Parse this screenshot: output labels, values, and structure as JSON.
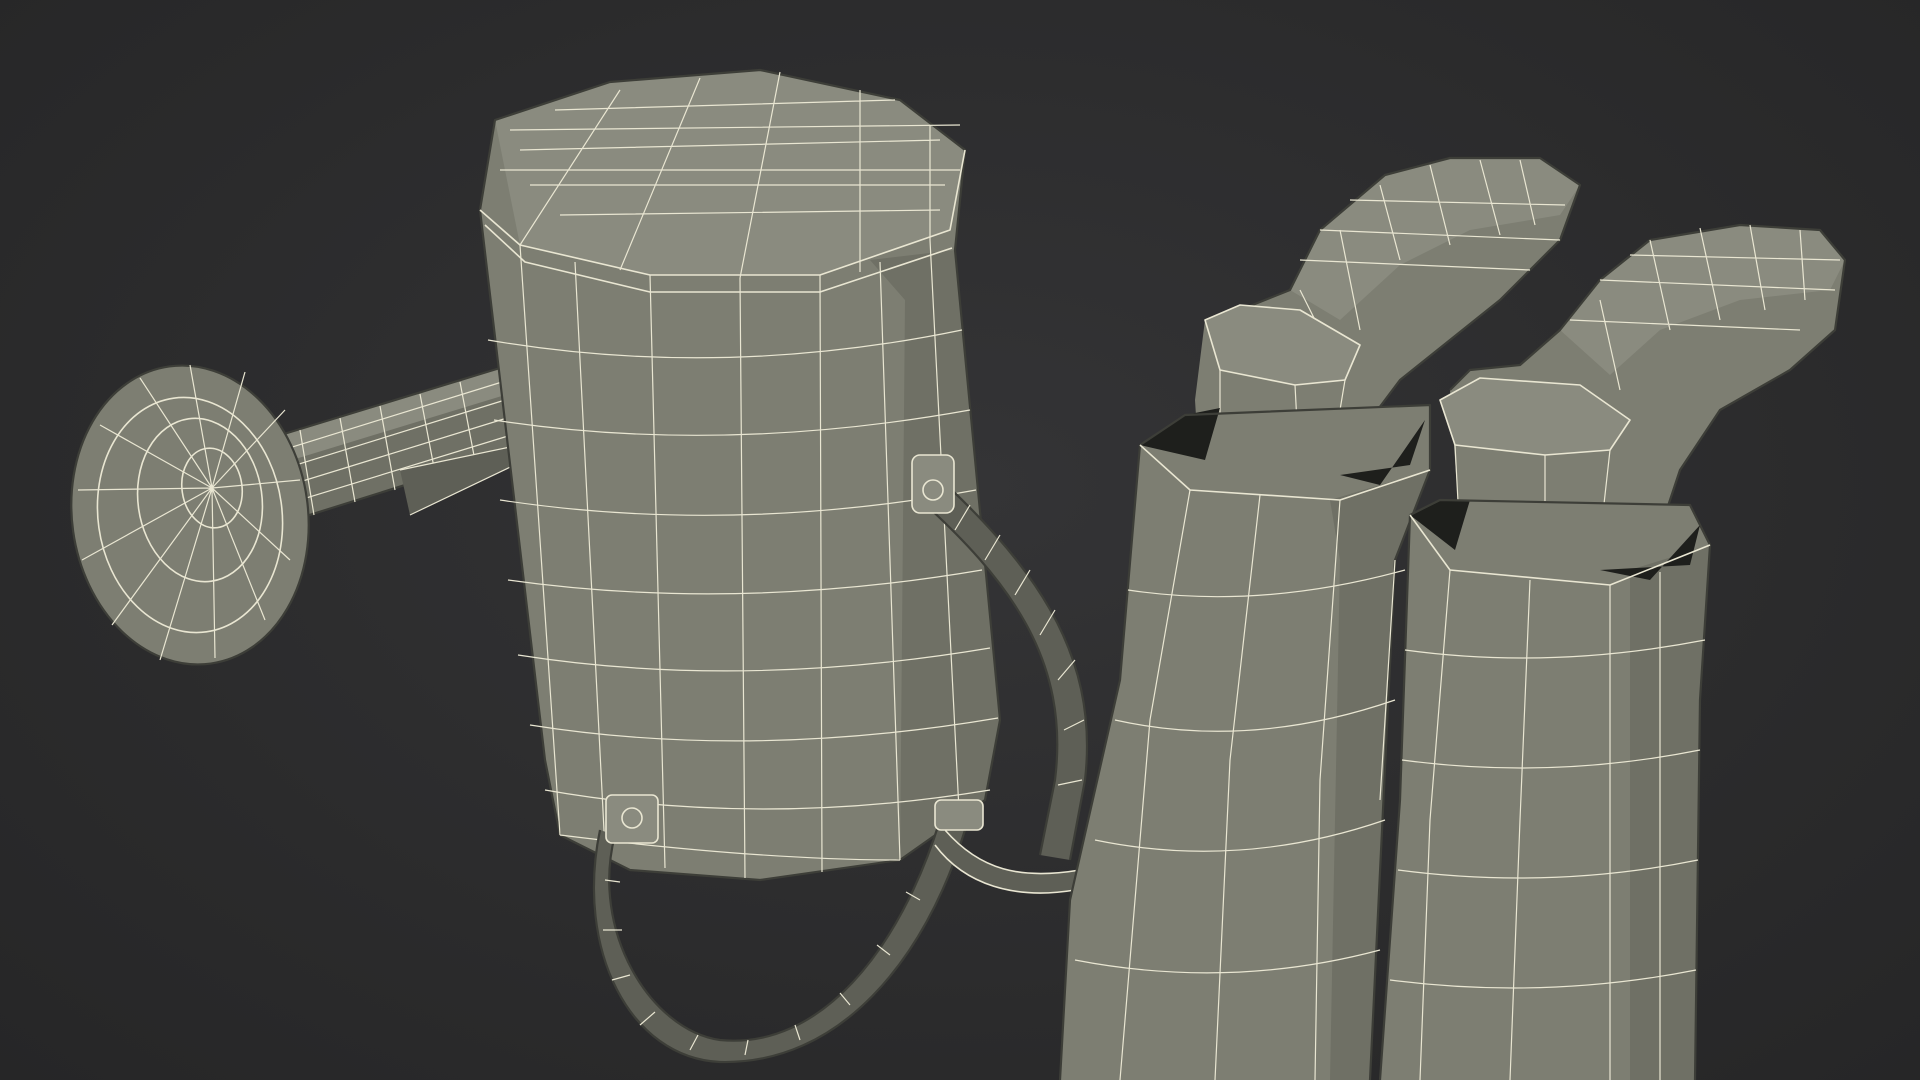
{
  "scene": {
    "subject": "watering-can-and-rubber-boots-wireframe",
    "background_color": "#2c2c2d",
    "mesh_color": "#7d7e72",
    "wire_color": "#e9e6d2"
  }
}
